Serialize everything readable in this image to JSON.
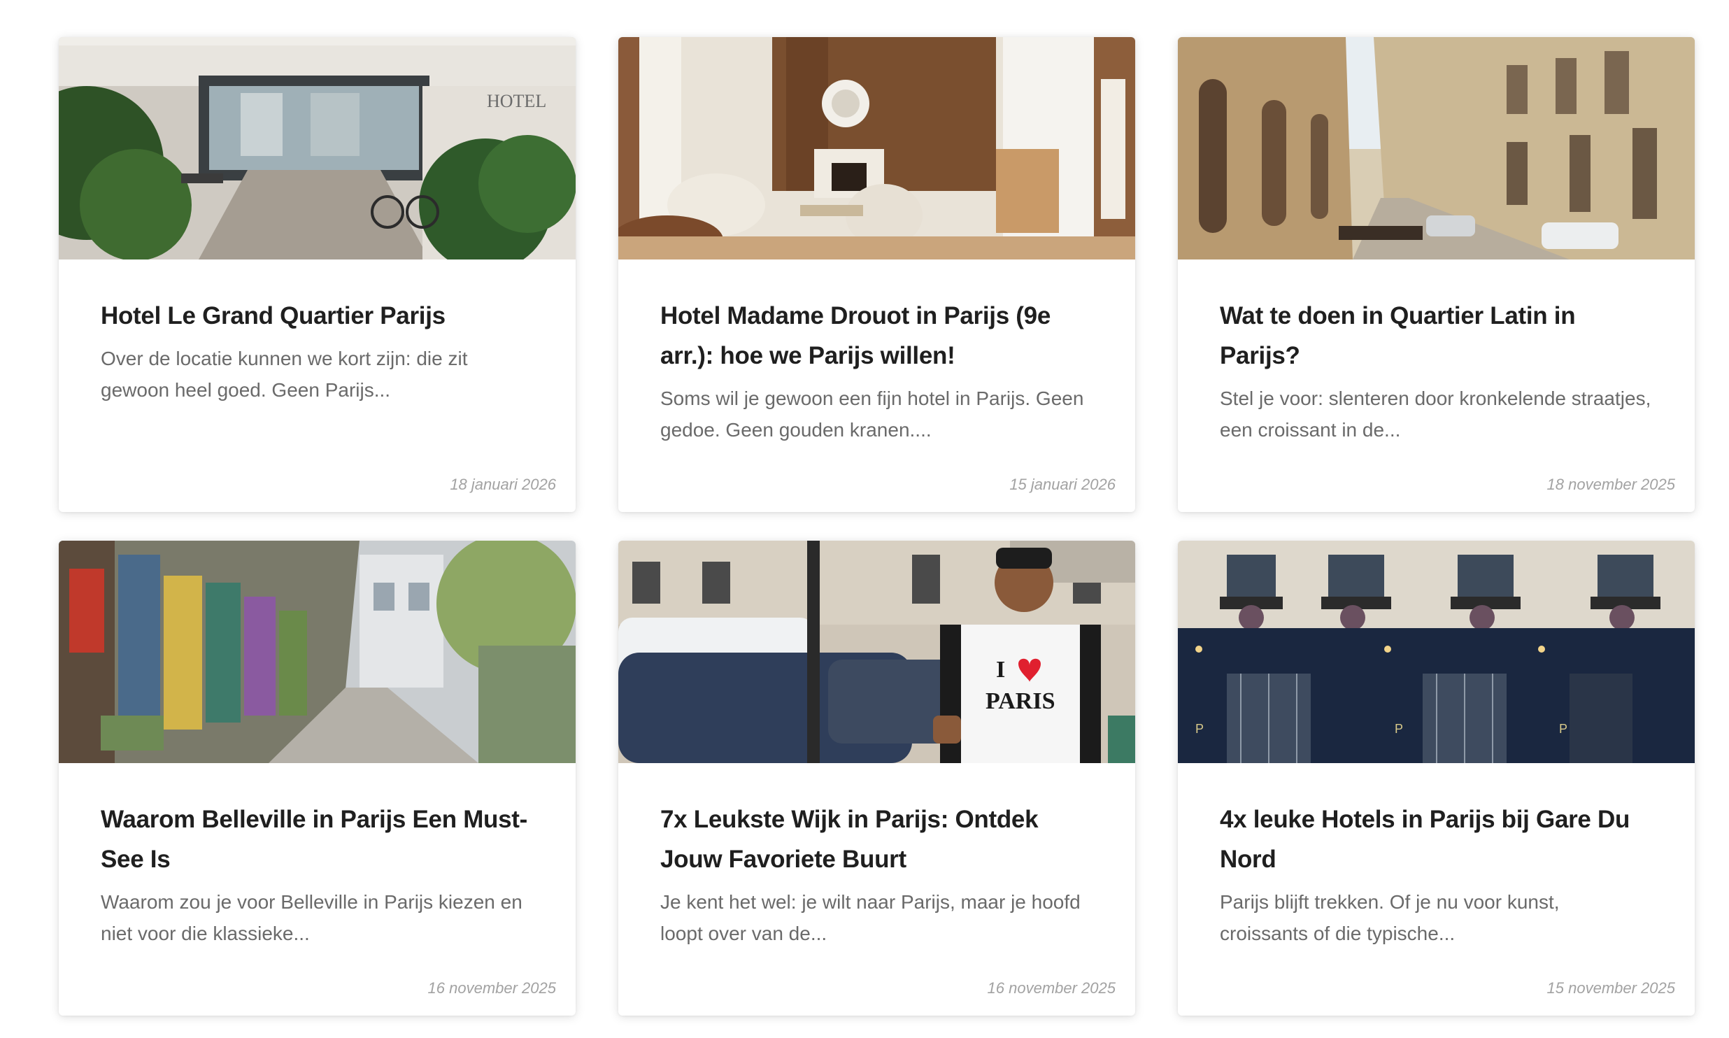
{
  "posts": [
    {
      "title": "Hotel Le Grand Quartier Parijs",
      "excerpt": "Over de locatie kunnen we kort zijn: die zit gewoon heel goed. Geen Parijs...",
      "date": "18 januari 2026",
      "image": "hotel-entrance-photo"
    },
    {
      "title": "Hotel Madame Drouot in Parijs (9e arr.): hoe we Parijs willen!",
      "excerpt": "Soms wil je gewoon een fijn hotel in Parijs. Geen gedoe. Geen gouden kranen....",
      "date": "15 januari 2026",
      "image": "hotel-lobby-photo"
    },
    {
      "title": "Wat te doen in Quartier Latin in Parijs?",
      "excerpt": "Stel je voor: slenteren door kronkelende straatjes, een croissant in de...",
      "date": "18 november 2025",
      "image": "paris-street-photo"
    },
    {
      "title": "Waarom Belleville in Parijs Een Must-See Is",
      "excerpt": "Waarom zou je voor Belleville in Parijs kiezen en niet voor die klassieke...",
      "date": "16 november 2025",
      "image": "graffiti-street-photo"
    },
    {
      "title": "7x Leukste Wijk in Parijs: Ontdek Jouw Favoriete Buurt",
      "excerpt": "Je kent het wel: je wilt naar Parijs, maar je hoofd loopt over van de...",
      "date": "16 november 2025",
      "image": "man-i-love-paris-shirt-photo"
    },
    {
      "title": "4x leuke Hotels in Parijs bij Gare Du Nord",
      "excerpt": "Parijs blijft trekken. Of je nu voor kunst, croissants of die typische...",
      "date": "15 november 2025",
      "image": "hotel-facade-photo"
    }
  ],
  "image_text": {
    "hotel_sign": "HOTEL",
    "shirt_line1": "I",
    "shirt_line2": "PARIS",
    "facade_letter": "P"
  },
  "colors": {
    "title": "#1f1f1f",
    "excerpt": "#6a6a6a",
    "date": "#a2a2a2",
    "facade_navy": "#1a2740",
    "shirt_heart": "#e0202f"
  }
}
